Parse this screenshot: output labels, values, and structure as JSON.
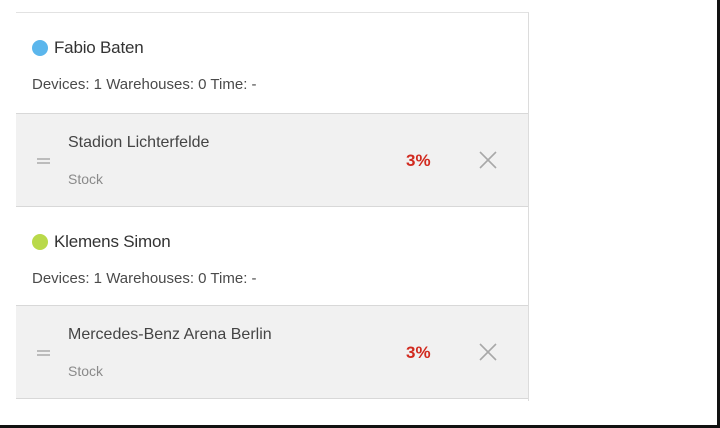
{
  "colors": {
    "user1_dot": "#5bb6ec",
    "user2_dot": "#b9d94a",
    "percent": "#d12a1f"
  },
  "users": [
    {
      "name": "Fabio Baten",
      "stats": "Devices: 1 Warehouses: 0 Time: -",
      "items": [
        {
          "title": "Stadion Lichterfelde",
          "subtitle": "Stock",
          "percent": "3%",
          "drag_icon": "drag-handle-icon",
          "remove_icon": "close-icon"
        }
      ]
    },
    {
      "name": "Klemens Simon",
      "stats": "Devices: 1 Warehouses: 0 Time: -",
      "items": [
        {
          "title": "Mercedes-Benz Arena Berlin",
          "subtitle": "Stock",
          "percent": "3%",
          "drag_icon": "drag-handle-icon",
          "remove_icon": "close-icon"
        }
      ]
    }
  ]
}
